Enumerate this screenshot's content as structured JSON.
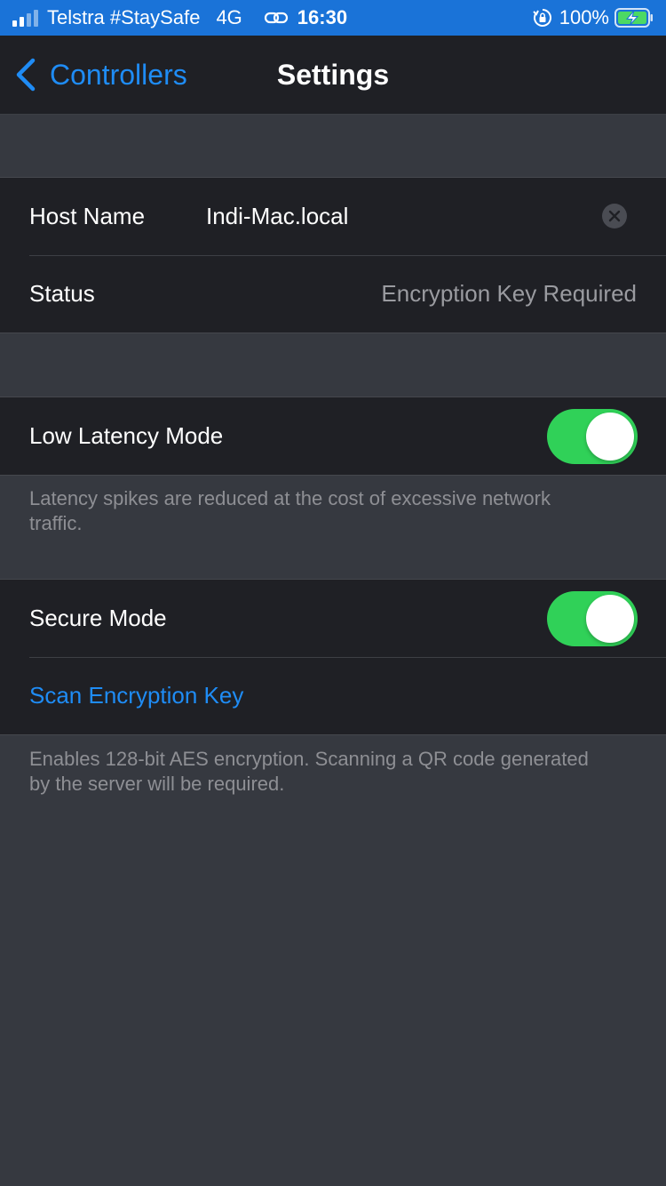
{
  "status_bar": {
    "carrier": "Telstra #StaySafe",
    "network": "4G",
    "time": "16:30",
    "battery": "100%",
    "icons": [
      "signal-icon",
      "link-icon",
      "orientation-lock-icon",
      "battery-charging-icon"
    ]
  },
  "nav": {
    "back_label": "Controllers",
    "title": "Settings"
  },
  "connection": {
    "host_label": "Host Name",
    "host_value": "Indi-Mac.local",
    "status_label": "Status",
    "status_value": "Encryption Key Required"
  },
  "latency": {
    "label": "Low Latency Mode",
    "enabled": true,
    "footer": "Latency spikes are reduced at the cost of excessive network traffic."
  },
  "security": {
    "label": "Secure Mode",
    "enabled": true,
    "scan_label": "Scan Encryption Key",
    "footer": "Enables 128-bit AES encryption. Scanning a QR code generated by the server will be required."
  },
  "colors": {
    "accent": "#1f8cf5",
    "toggle_on": "#30d158",
    "status_bar": "#1a73d8"
  }
}
